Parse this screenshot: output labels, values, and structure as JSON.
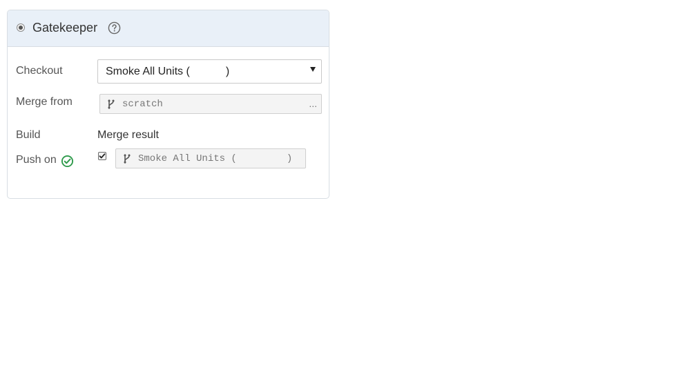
{
  "panel": {
    "title": "Gatekeeper",
    "radio_selected": true
  },
  "form": {
    "checkout_label": "Checkout",
    "checkout_value": "Smoke All Units (",
    "checkout_value_close": ")",
    "merge_from_label": "Merge from",
    "merge_from_value": "scratch",
    "build_label": "Build",
    "merge_result_label": "Merge result",
    "push_on_label": "Push on",
    "push_checked": true,
    "push_value": "Smoke All Units (",
    "push_value_close": ")"
  },
  "colors": {
    "header_bg": "#e9f0f8",
    "success": "#2e9a4b",
    "border": "#d7dde3"
  },
  "icons": {
    "help": "help-circle-icon",
    "branch": "git-branch-icon",
    "check": "check-circle-icon",
    "dropdown": "chevron-down-icon"
  }
}
